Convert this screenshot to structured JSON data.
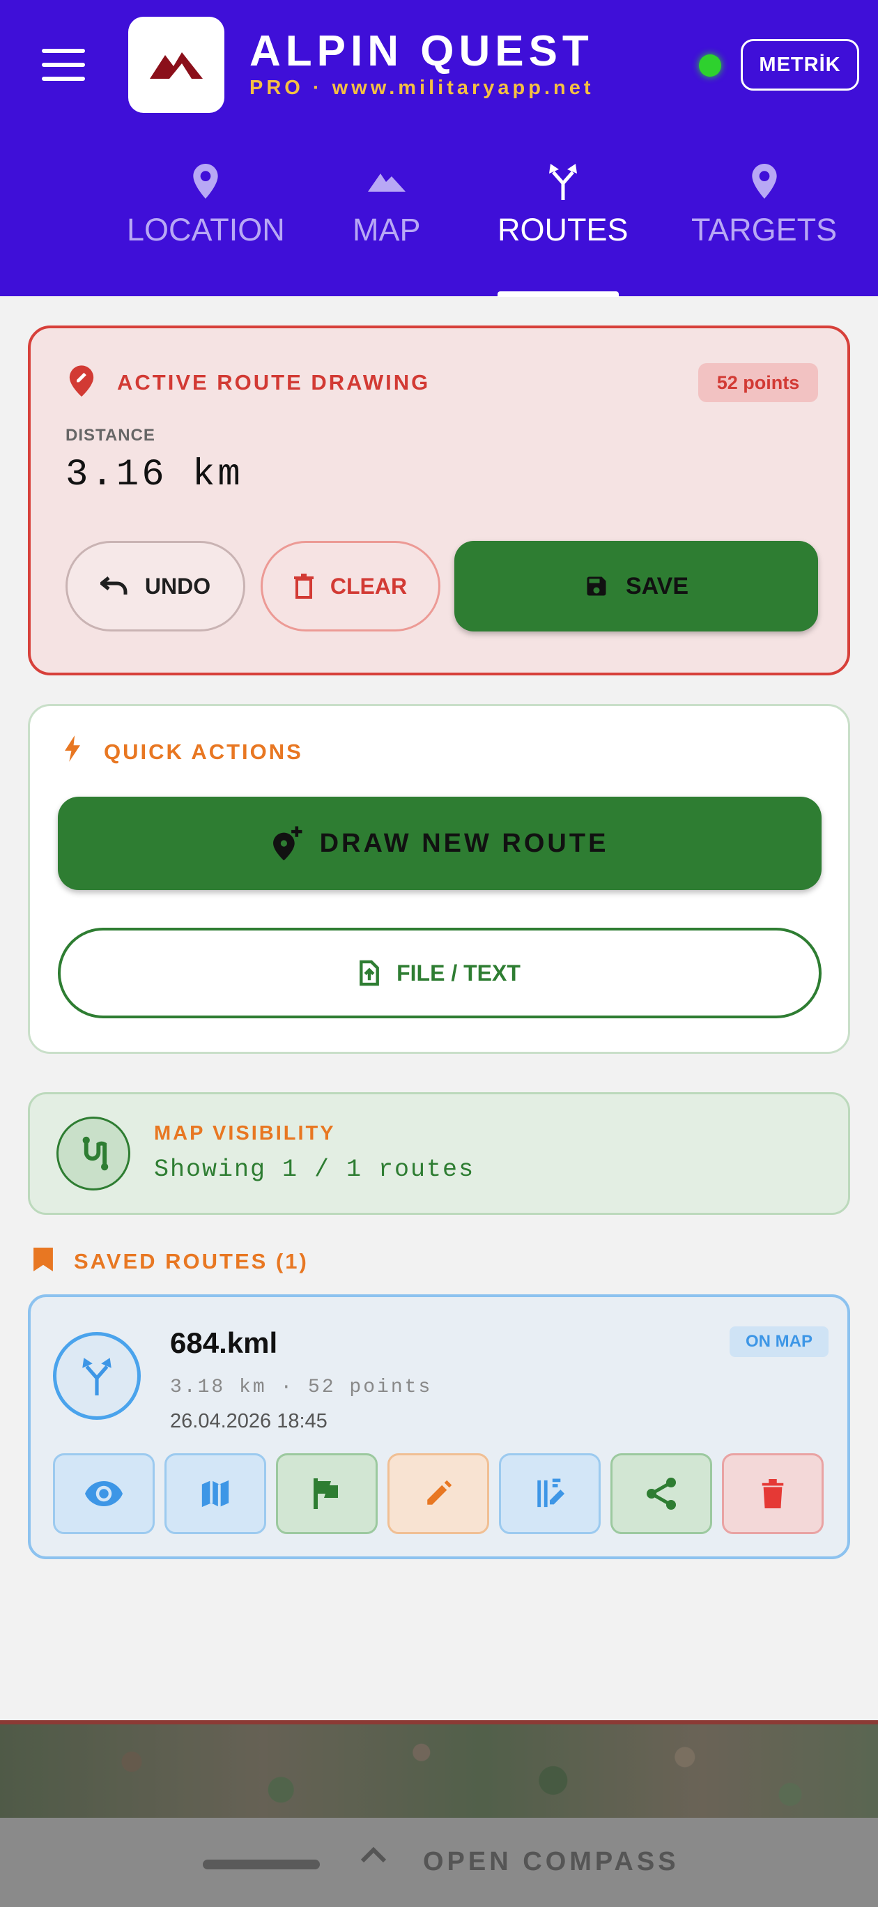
{
  "header": {
    "title": "ALPIN QUEST",
    "subtitle": "PRO · www.militaryapp.net",
    "metric_label": "METRİK",
    "status_color": "#2ed12e",
    "brand_color": "#3f0fd8"
  },
  "tabs": [
    {
      "label": "LOCATION",
      "icon": "map-pin-icon",
      "active": false
    },
    {
      "label": "MAP",
      "icon": "mountains-icon",
      "active": false
    },
    {
      "label": "ROUTES",
      "icon": "route-fork-icon",
      "active": true
    },
    {
      "label": "TARGETS",
      "icon": "map-pin-icon",
      "active": false
    }
  ],
  "active_route": {
    "title": "ACTIVE ROUTE DRAWING",
    "points_badge": "52 points",
    "distance_label": "DISTANCE",
    "distance_value": "3.16 km",
    "undo_label": "UNDO",
    "clear_label": "CLEAR",
    "save_label": "SAVE"
  },
  "quick_actions": {
    "title": "QUICK ACTIONS",
    "draw_label": "DRAW NEW ROUTE",
    "file_label": "FILE / TEXT"
  },
  "map_visibility": {
    "title": "MAP VISIBILITY",
    "text": "Showing 1 / 1 routes"
  },
  "saved_routes": {
    "title": "SAVED ROUTES (1)",
    "items": [
      {
        "name": "684.kml",
        "meta": "3.18 km · 52 points",
        "date": "26.04.2026  18:45",
        "badge": "ON MAP",
        "actions": [
          "eye-icon",
          "map-icon",
          "flag-icon",
          "pencil-icon",
          "edit-columns-icon",
          "share-icon",
          "trash-icon"
        ]
      }
    ]
  },
  "bottom": {
    "compass_label": "OPEN COMPASS"
  }
}
